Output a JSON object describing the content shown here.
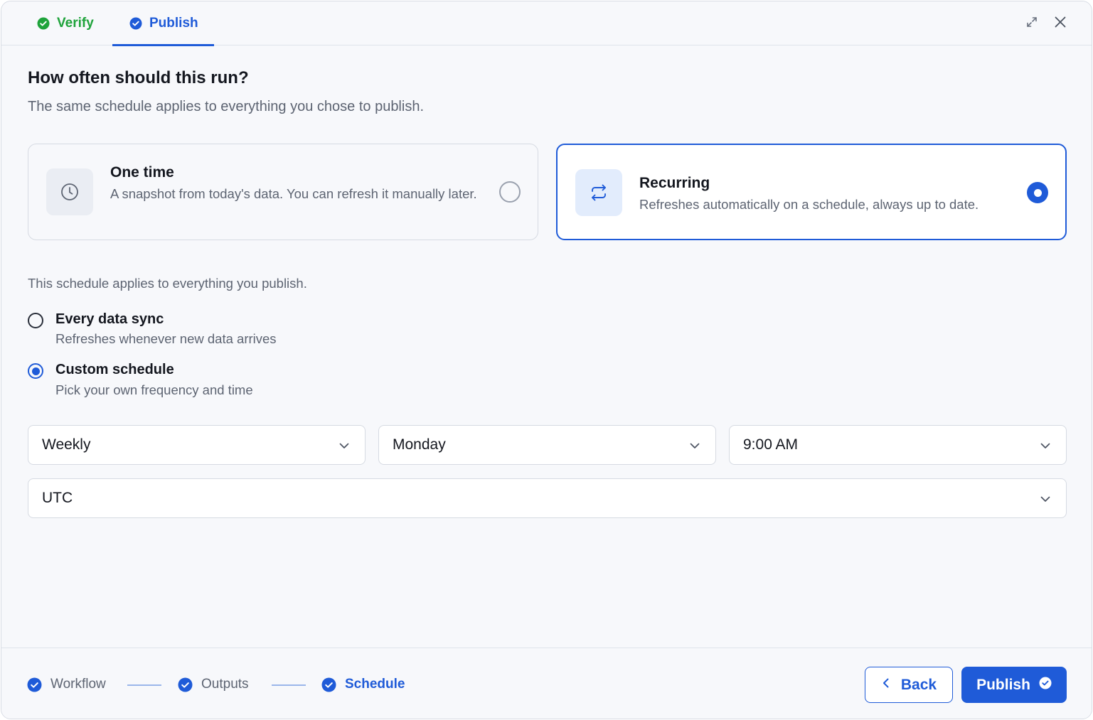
{
  "header": {
    "tabs": [
      {
        "label": "Verify",
        "state": "complete"
      },
      {
        "label": "Publish",
        "state": "active"
      }
    ],
    "expand_icon": "expand-icon",
    "close_icon": "close-icon"
  },
  "main": {
    "title": "How often should this run?",
    "subtitle": "The same schedule applies to everything you chose to publish.",
    "cards": {
      "one_time": {
        "icon": "clock-icon",
        "title": "One time",
        "description": "A snapshot from today's data. You can refresh it manually later.",
        "selected": false
      },
      "recurring": {
        "icon": "repeat-icon",
        "title": "Recurring",
        "description": "Refreshes automatically on a schedule, always up to date.",
        "selected": true
      }
    },
    "schedule_note": "This schedule applies to everything you publish.",
    "options": {
      "every_sync": {
        "label": "Every data sync",
        "description": "Refreshes whenever new data arrives",
        "selected": false
      },
      "custom": {
        "label": "Custom schedule",
        "description": "Pick your own frequency and time",
        "selected": true
      }
    },
    "selects": {
      "frequency": "Weekly",
      "day": "Monday",
      "time": "9:00 AM",
      "timezone": "UTC"
    }
  },
  "footer": {
    "steps": [
      {
        "label": "Workflow",
        "state": "complete"
      },
      {
        "label": "Outputs",
        "state": "complete"
      },
      {
        "label": "Schedule",
        "state": "active"
      }
    ],
    "back_label": "Back",
    "publish_label": "Publish"
  },
  "colors": {
    "accent": "#1f5bd8",
    "success": "#1fa33b",
    "muted_text": "#5d6472",
    "border": "#d6dae2"
  }
}
